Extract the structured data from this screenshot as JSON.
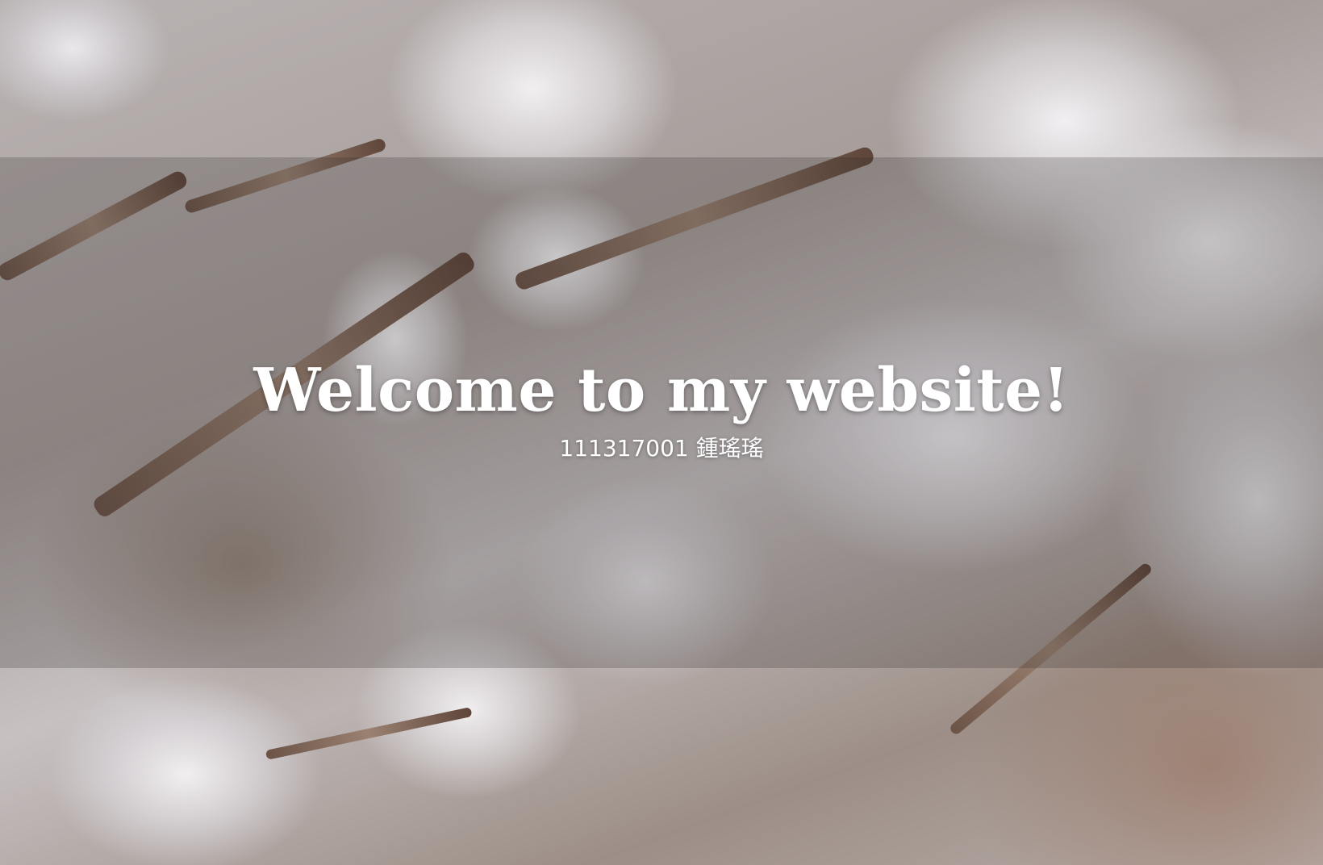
{
  "hero": {
    "title": "Welcome to my website!",
    "subtitle": "111317001 鍾瑤瑤",
    "background_image": "cherry-blossom-branch-with-bee",
    "text_color": "#ffffff"
  }
}
